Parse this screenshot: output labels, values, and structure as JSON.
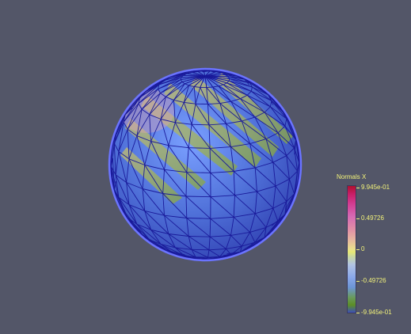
{
  "legend": {
    "title": "Normals X",
    "labels": {
      "max": "9.945e-01",
      "upper": "0.49726",
      "mid": "0",
      "lower": "-0.49726",
      "min": "-9.945e-01"
    }
  },
  "colors": {
    "background": "#535668",
    "wireframe": "#1a1a9a",
    "surface_blue": "#5b80d8",
    "surface_green": "#a7c04a",
    "surface_pink": "#d6a4b6"
  },
  "icons": {
    "colorbar": "scalar-bar-legend"
  }
}
